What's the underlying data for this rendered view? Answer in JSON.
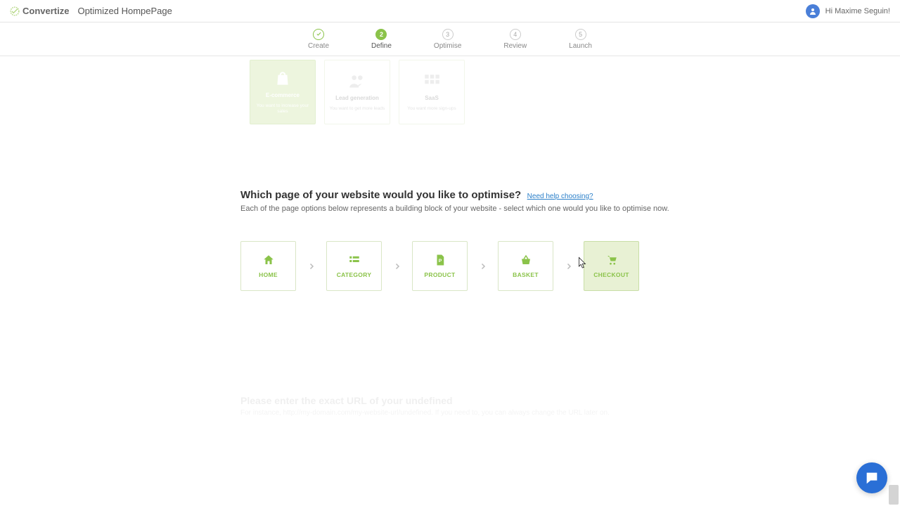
{
  "header": {
    "brand": "Convertize",
    "page_title": "Optimized HompePage",
    "greeting": "Hi Maxime Seguin!"
  },
  "stepper": {
    "steps": [
      {
        "num": "✓",
        "label": "Create"
      },
      {
        "num": "2",
        "label": "Define"
      },
      {
        "num": "3",
        "label": "Optimise"
      },
      {
        "num": "4",
        "label": "Review"
      },
      {
        "num": "5",
        "label": "Launch"
      }
    ],
    "active_index": 1,
    "done_index": 0
  },
  "goals": [
    {
      "title": "E-commerce",
      "sub": "You want to increase your sales",
      "selected": true
    },
    {
      "title": "Lead generation",
      "sub": "You want to get more leads",
      "selected": false
    },
    {
      "title": "SaaS",
      "sub": "You want more sign-ups",
      "selected": false
    }
  ],
  "question": {
    "heading": "Which page of your website would you like to optimise?",
    "help_link": "Need help choosing?",
    "sub": "Each of the page options below represents a building block of your website - select which one would you like to optimise now."
  },
  "pages": [
    {
      "label": "HOME",
      "icon": "home"
    },
    {
      "label": "CATEGORY",
      "icon": "list"
    },
    {
      "label": "PRODUCT",
      "icon": "file"
    },
    {
      "label": "BASKET",
      "icon": "basket"
    },
    {
      "label": "CHECKOUT",
      "icon": "cart"
    }
  ],
  "hovered_page_index": 4,
  "url_section": {
    "title": "Please enter the exact URL of your undefined",
    "sub": "For instance, http://my-domain.com/my-website-url/undefined. If you need to, you can always change the URL later on."
  },
  "colors": {
    "accent": "#8bc34a",
    "chat": "#2a6fd6"
  }
}
